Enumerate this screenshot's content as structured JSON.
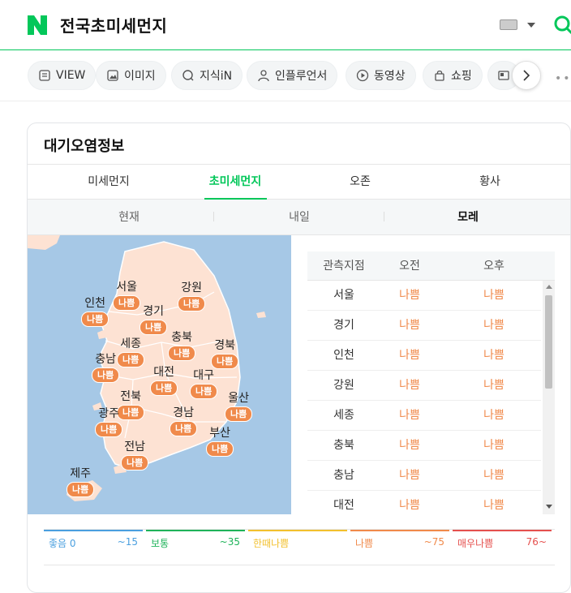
{
  "header": {
    "title": "전국초미세먼지",
    "brand_color": "#03c75a"
  },
  "search_tabs": [
    {
      "label": "VIEW",
      "icon": "view-icon"
    },
    {
      "label": "이미지",
      "icon": "image-icon"
    },
    {
      "label": "지식iN",
      "icon": "kin-icon"
    },
    {
      "label": "인플루언서",
      "icon": "person-icon"
    },
    {
      "label": "동영상",
      "icon": "play-icon"
    },
    {
      "label": "쇼핑",
      "icon": "bag-icon"
    }
  ],
  "card": {
    "title": "대기오염정보",
    "pollutant_tabs": [
      "미세먼지",
      "초미세먼지",
      "오존",
      "황사"
    ],
    "active_pollutant": "초미세먼지",
    "day_tabs": [
      "현재",
      "내일",
      "모레"
    ],
    "active_day": "모레"
  },
  "map": {
    "regions": [
      {
        "name": "서울",
        "grade": "나쁨"
      },
      {
        "name": "강원",
        "grade": "나쁨"
      },
      {
        "name": "인천",
        "grade": "나쁨"
      },
      {
        "name": "경기",
        "grade": "나쁨"
      },
      {
        "name": "세종",
        "grade": "나쁨"
      },
      {
        "name": "충북",
        "grade": "나쁨"
      },
      {
        "name": "경북",
        "grade": "나쁨"
      },
      {
        "name": "충남",
        "grade": "나쁨"
      },
      {
        "name": "대전",
        "grade": "나쁨"
      },
      {
        "name": "대구",
        "grade": "나쁨"
      },
      {
        "name": "전북",
        "grade": "나쁨"
      },
      {
        "name": "울산",
        "grade": "나쁨"
      },
      {
        "name": "광주",
        "grade": "나쁨"
      },
      {
        "name": "경남",
        "grade": "나쁨"
      },
      {
        "name": "부산",
        "grade": "나쁨"
      },
      {
        "name": "전남",
        "grade": "나쁨"
      },
      {
        "name": "제주",
        "grade": "나쁨"
      }
    ]
  },
  "table": {
    "headers": [
      "관측지점",
      "오전",
      "오후"
    ],
    "rows": [
      {
        "region": "서울",
        "am": "나쁨",
        "pm": "나쁨"
      },
      {
        "region": "경기",
        "am": "나쁨",
        "pm": "나쁨"
      },
      {
        "region": "인천",
        "am": "나쁨",
        "pm": "나쁨"
      },
      {
        "region": "강원",
        "am": "나쁨",
        "pm": "나쁨"
      },
      {
        "region": "세종",
        "am": "나쁨",
        "pm": "나쁨"
      },
      {
        "region": "충북",
        "am": "나쁨",
        "pm": "나쁨"
      },
      {
        "region": "충남",
        "am": "나쁨",
        "pm": "나쁨"
      },
      {
        "region": "대전",
        "am": "나쁨",
        "pm": "나쁨"
      }
    ]
  },
  "legend": [
    {
      "label": "좋음 0",
      "range": "~15",
      "color": "#4a9fdf"
    },
    {
      "label": "보통",
      "range": "~35",
      "color": "#1fb35a"
    },
    {
      "label": "한때나쁨",
      "range": "",
      "color": "#f2c02e"
    },
    {
      "label": "나쁨",
      "range": "~75",
      "color": "#f08a4b"
    },
    {
      "label": "매우나쁨",
      "range": "76~",
      "color": "#e5504e"
    }
  ]
}
